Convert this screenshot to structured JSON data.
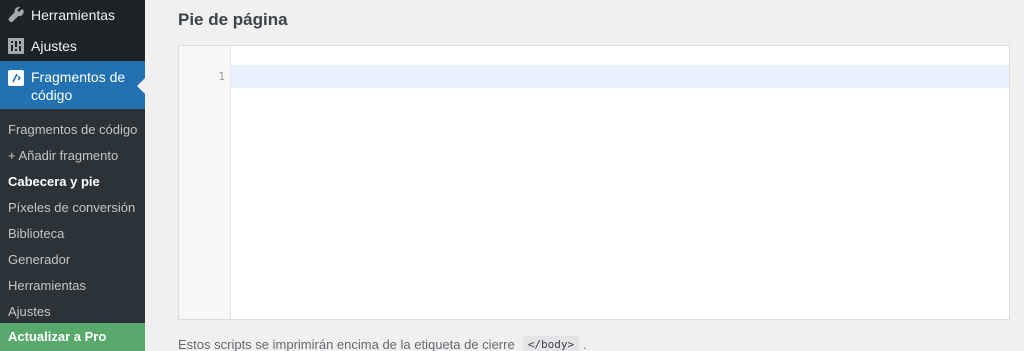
{
  "sidebar": {
    "menu": [
      {
        "label": "Herramientas",
        "icon": "wrench-icon"
      },
      {
        "label": "Ajustes",
        "icon": "settings-sliders-icon"
      },
      {
        "label": "Fragmentos de código",
        "icon": "code-snippets-icon"
      }
    ],
    "submenu": [
      {
        "label": "Fragmentos de código"
      },
      {
        "label": "+ Añadir fragmento"
      },
      {
        "label": "Cabecera y pie"
      },
      {
        "label": "Píxeles de conversión"
      },
      {
        "label": "Biblioteca"
      },
      {
        "label": "Generador"
      },
      {
        "label": "Herramientas"
      },
      {
        "label": "Ajustes"
      }
    ],
    "upgrade_label": "Actualizar a Pro",
    "colors": {
      "bg": "#1d2327",
      "submenu_bg": "#2c3338",
      "active": "#2271b1",
      "upgrade": "#5aa96c"
    }
  },
  "main": {
    "section_title": "Pie de página",
    "editor": {
      "line_number": "1",
      "content": ""
    },
    "help_text": "Estos scripts se imprimirán encima de la etiqueta de cierre",
    "help_code": "</body>",
    "help_suffix": "."
  }
}
